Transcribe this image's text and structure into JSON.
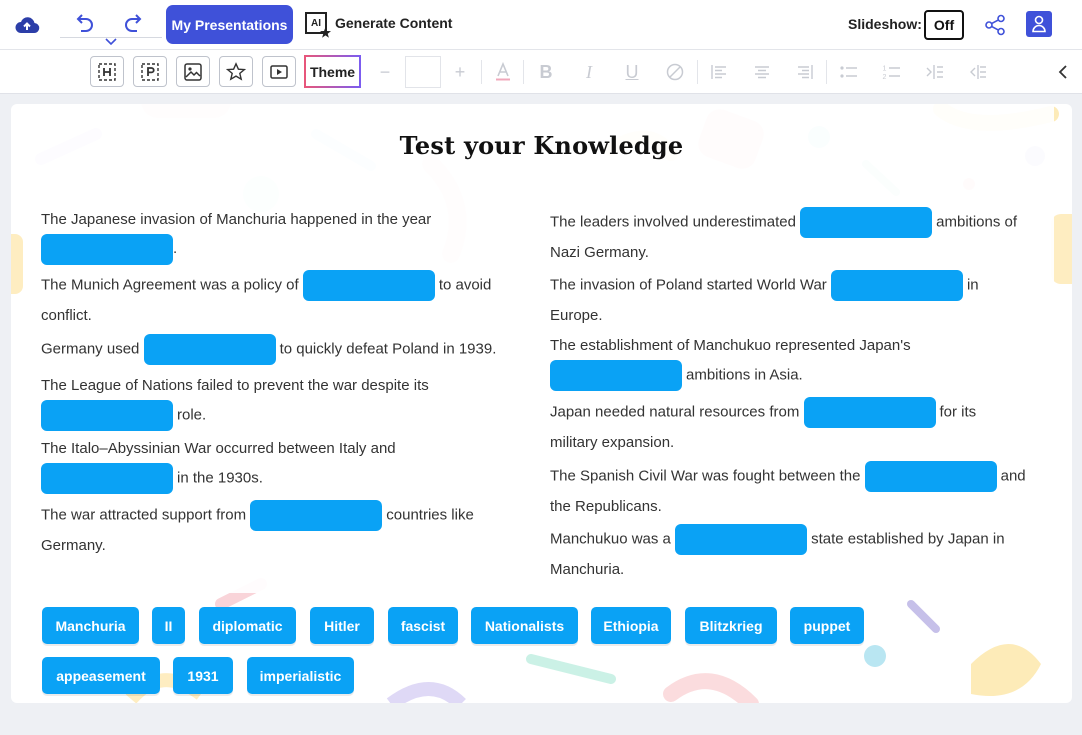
{
  "header": {
    "my_presentations": "My Presentations",
    "ai_badge": "AI",
    "generate_content": "Generate Content",
    "slideshow_label": "Slideshow:",
    "slideshow_value": "Off"
  },
  "toolbar": {
    "theme_label": "Theme",
    "font_size_value": ""
  },
  "colors": {
    "brand": "#3f51d9",
    "blank": "#0aa2f5"
  },
  "slide": {
    "title": "Test your Knowledge",
    "left_questions": [
      {
        "before": "The Japanese invasion of Manchuria happened in the year",
        "after": "."
      },
      {
        "before": "The Munich Agreement was a policy of",
        "after": "to avoid conflict."
      },
      {
        "before": "Germany used",
        "after": "to quickly defeat Poland in 1939."
      },
      {
        "before": "The League of Nations failed to prevent the war despite its",
        "after": "role."
      },
      {
        "before": "The Italo–Abyssinian War occurred between Italy and",
        "after": "in the 1930s."
      },
      {
        "before": "The war attracted support from",
        "after": "countries like Germany."
      }
    ],
    "right_questions": [
      {
        "before": "The leaders involved underestimated",
        "after": "ambitions of Nazi Germany."
      },
      {
        "before": "The invasion of Poland started World War",
        "after": "in Europe."
      },
      {
        "before": "The establishment of Manchukuo represented Japan's",
        "after": "ambitions in Asia."
      },
      {
        "before": "Japan needed natural resources from",
        "after": "for its military expansion."
      },
      {
        "before": "The Spanish Civil War was fought between the",
        "after": "and the Republicans."
      },
      {
        "before": "Manchukuo was a",
        "after": "state established by Japan in Manchuria."
      }
    ],
    "word_bank": [
      "Manchuria",
      "II",
      "diplomatic",
      "Hitler",
      "fascist",
      "Nationalists",
      "Ethiopia",
      "Blitzkrieg",
      "puppet",
      "appeasement",
      "1931",
      "imperialistic"
    ]
  }
}
